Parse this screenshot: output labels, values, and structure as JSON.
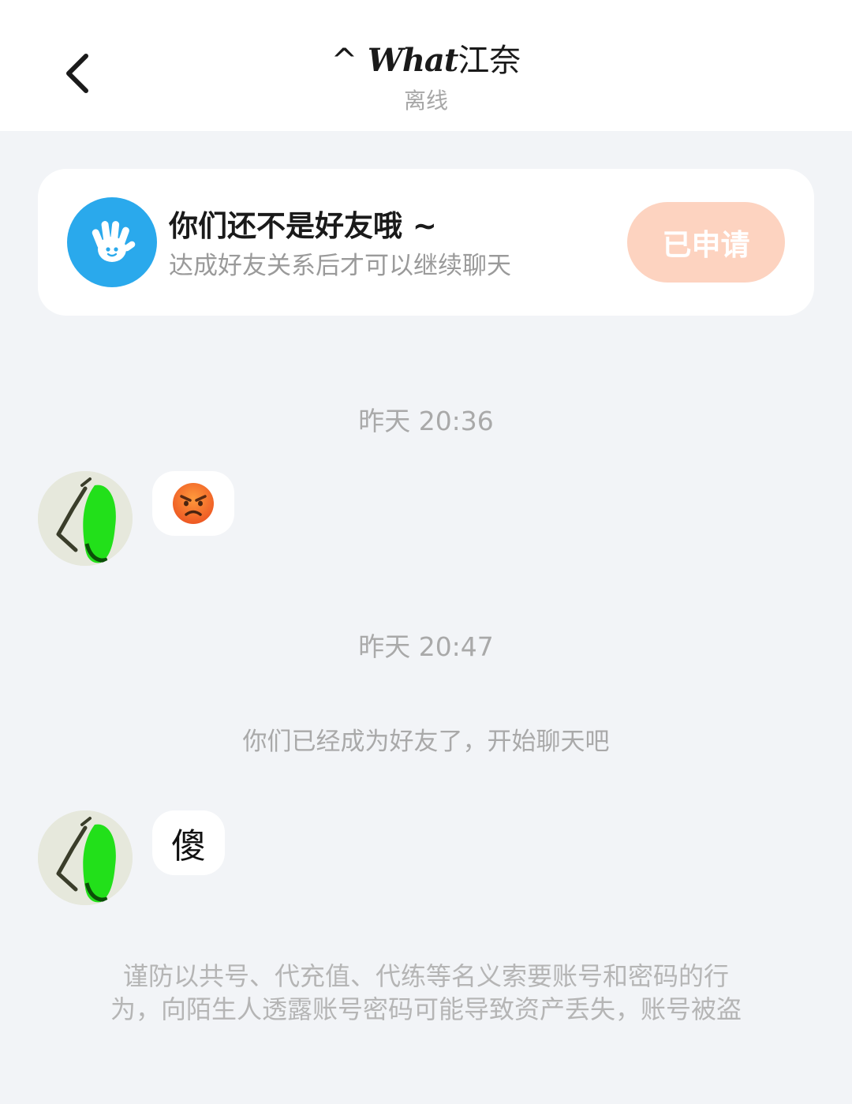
{
  "header": {
    "back_icon": "chevron-left-icon",
    "title_prefix": "^ ",
    "title_script": "What",
    "title_name": "江奈",
    "status": "离线"
  },
  "friend_card": {
    "icon": "waving-hand-icon",
    "title": "你们还不是好友哦 ~",
    "subtitle": "达成好友关系后才可以继续聊天",
    "button_label": "已申请",
    "accent_color": "#2aa9ec",
    "button_color": "#fdd3c0"
  },
  "messages": [
    {
      "type": "timestamp",
      "text": "昨天 20:36"
    },
    {
      "type": "incoming",
      "sender_avatar": "green-hair-avatar",
      "content_icon": "angry-face-emoji"
    },
    {
      "type": "timestamp",
      "text": "昨天 20:47"
    },
    {
      "type": "system",
      "text": "你们已经成为好友了，开始聊天吧"
    },
    {
      "type": "incoming",
      "sender_avatar": "green-hair-avatar",
      "text": "傻"
    }
  ],
  "warning": {
    "line1": "谨防以共号、代充值、代练等名义索要账号和密码的行",
    "line2": "为，向陌生人透露账号密码可能导致资产丢失，账号被盗"
  }
}
